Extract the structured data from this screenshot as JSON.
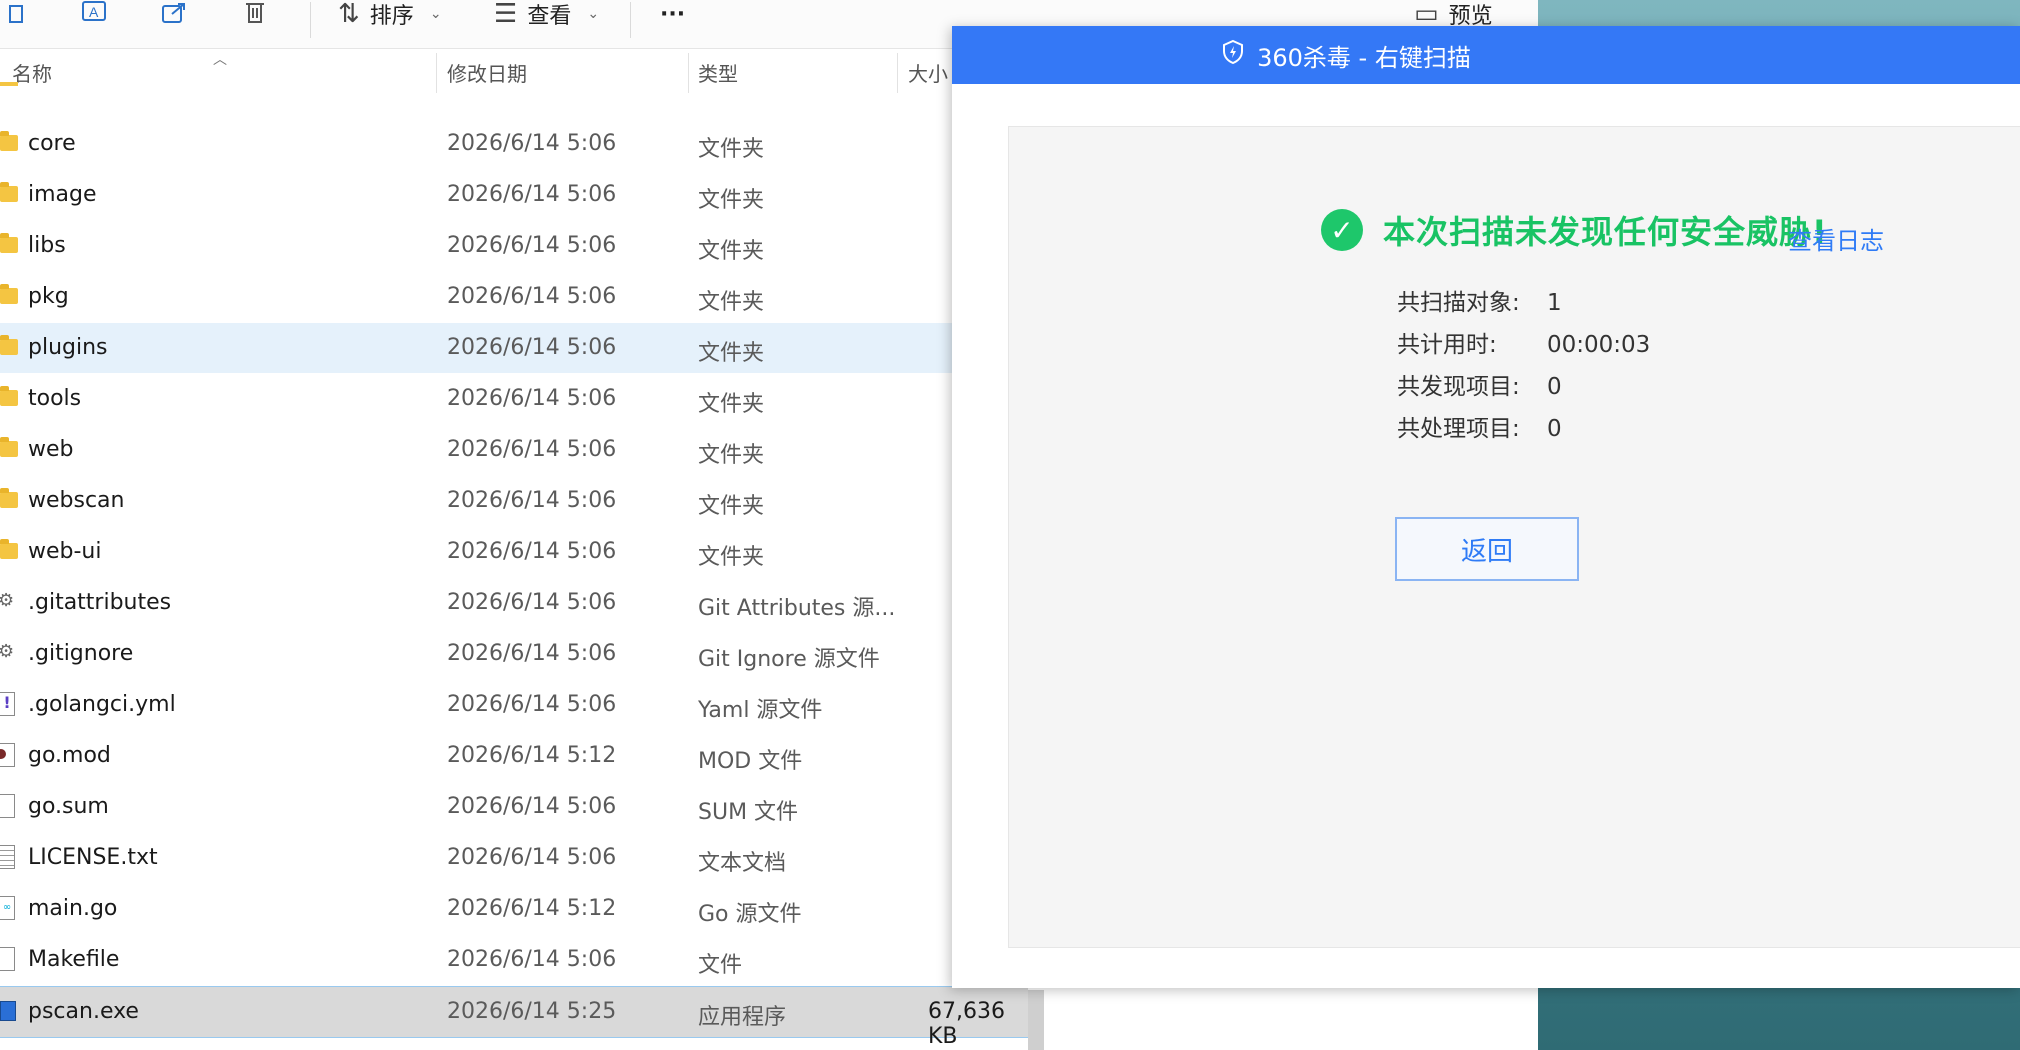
{
  "toolbar": {
    "sort_label": "排序",
    "view_label": "查看",
    "more_label": "···",
    "preview_label": "预览"
  },
  "columns": {
    "name": "名称",
    "date": "修改日期",
    "type": "类型",
    "size": "大小"
  },
  "files": [
    {
      "name": "core",
      "date": "2026/6/14 5:06",
      "type": "文件夹",
      "size": "",
      "icon": "folder-icon"
    },
    {
      "name": "image",
      "date": "2026/6/14 5:06",
      "type": "文件夹",
      "size": "",
      "icon": "folder-icon"
    },
    {
      "name": "libs",
      "date": "2026/6/14 5:06",
      "type": "文件夹",
      "size": "",
      "icon": "folder-icon"
    },
    {
      "name": "pkg",
      "date": "2026/6/14 5:06",
      "type": "文件夹",
      "size": "",
      "icon": "folder-icon"
    },
    {
      "name": "plugins",
      "date": "2026/6/14 5:06",
      "type": "文件夹",
      "size": "",
      "icon": "folder-icon"
    },
    {
      "name": "tools",
      "date": "2026/6/14 5:06",
      "type": "文件夹",
      "size": "",
      "icon": "folder-icon"
    },
    {
      "name": "web",
      "date": "2026/6/14 5:06",
      "type": "文件夹",
      "size": "",
      "icon": "folder-icon"
    },
    {
      "name": "webscan",
      "date": "2026/6/14 5:06",
      "type": "文件夹",
      "size": "",
      "icon": "folder-icon"
    },
    {
      "name": "web-ui",
      "date": "2026/6/14 5:06",
      "type": "文件夹",
      "size": "",
      "icon": "folder-icon"
    },
    {
      "name": ".gitattributes",
      "date": "2026/6/14 5:06",
      "type": "Git Attributes 源...",
      "size": "",
      "icon": "gear-file-icon"
    },
    {
      "name": ".gitignore",
      "date": "2026/6/14 5:06",
      "type": "Git Ignore 源文件",
      "size": "",
      "icon": "gear-file-icon"
    },
    {
      "name": ".golangci.yml",
      "date": "2026/6/14 5:06",
      "type": "Yaml 源文件",
      "size": "",
      "icon": "yaml-file-icon"
    },
    {
      "name": "go.mod",
      "date": "2026/6/14 5:12",
      "type": "MOD 文件",
      "size": "",
      "icon": "mod-file-icon"
    },
    {
      "name": "go.sum",
      "date": "2026/6/14 5:06",
      "type": "SUM 文件",
      "size": "",
      "icon": "blank-file-icon"
    },
    {
      "name": "LICENSE.txt",
      "date": "2026/6/14 5:06",
      "type": "文本文档",
      "size": "",
      "icon": "text-file-icon"
    },
    {
      "name": "main.go",
      "date": "2026/6/14 5:12",
      "type": "Go 源文件",
      "size": "",
      "icon": "go-file-icon"
    },
    {
      "name": "Makefile",
      "date": "2026/6/14 5:06",
      "type": "文件",
      "size": "",
      "icon": "blank-file-icon"
    },
    {
      "name": "pscan.exe",
      "date": "2026/6/14 5:25",
      "type": "应用程序",
      "size": "67,636 KB",
      "icon": "exe-file-icon"
    }
  ],
  "dialog": {
    "title": "360杀毒 - 右键扫描",
    "result": "本次扫描未发现任何安全威胁!",
    "view_log": "查看日志",
    "stats": [
      {
        "label": "共扫描对象:",
        "value": "1"
      },
      {
        "label": "共计用时:",
        "value": "00:00:03"
      },
      {
        "label": "共发现项目:",
        "value": "0"
      },
      {
        "label": "共处理项目:",
        "value": "0"
      }
    ],
    "return_label": "返回"
  },
  "colors": {
    "title_bar": "#3478f6",
    "success_green": "#19c364",
    "link_blue": "#2f7bf6",
    "selected_row": "#d9d9d9",
    "hover_row": "#e5f1fb"
  }
}
